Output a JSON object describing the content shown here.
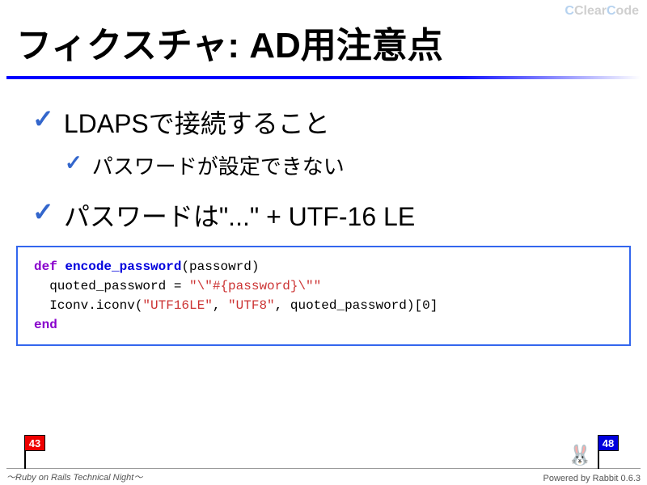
{
  "logo": {
    "c1": "C",
    "clear": "Clear",
    "c2": "C",
    "code": "ode"
  },
  "title": "フィクスチャ: AD用注意点",
  "bullets": {
    "item1": "LDAPSで接続すること",
    "item1_sub": "パスワードが設定できない",
    "item2": "パスワードは\"...\" + UTF-16 LE"
  },
  "code": {
    "line1_def": "def",
    "line1_fn": "encode_password",
    "line1_rest": "(passowrd)",
    "line2_pre": "  quoted_password = ",
    "line2_str": "\"\\\"#{password}\\\"\"",
    "line3_pre": "  Iconv.iconv(",
    "line3_str1": "\"UTF16LE\"",
    "line3_mid": ", ",
    "line3_str2": "\"UTF8\"",
    "line3_rest": ", quoted_password)[0]",
    "line4": "end"
  },
  "flags": {
    "left": "43",
    "right": "48"
  },
  "footer": {
    "left": "〜Ruby on Rails Technical Night〜",
    "right": "Powered by Rabbit 0.6.3"
  },
  "rabbit_emoji": "🐰"
}
